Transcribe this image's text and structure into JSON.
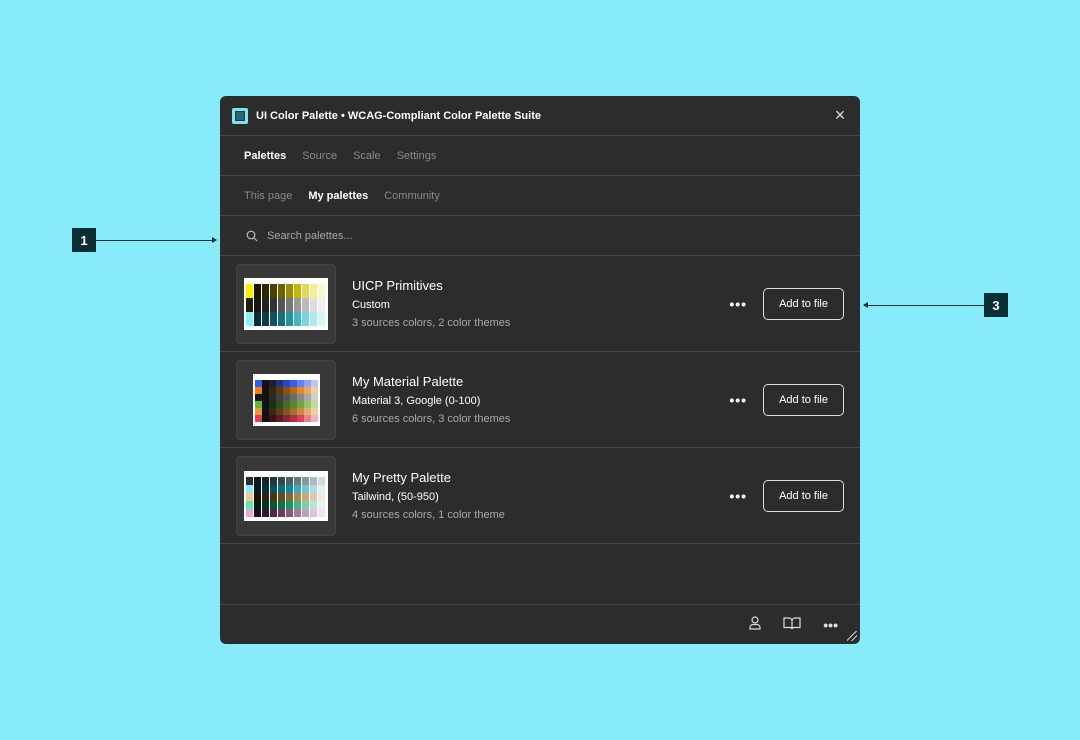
{
  "window": {
    "title": "UI Color Palette • WCAG-Compliant Color Palette Suite"
  },
  "tabs": [
    "Palettes",
    "Source",
    "Scale",
    "Settings"
  ],
  "subtabs": [
    "This page",
    "My palettes",
    "Community"
  ],
  "search": {
    "placeholder": "Search palettes..."
  },
  "palettes": [
    {
      "name": "UICP Primitives",
      "type": "Custom",
      "meta": "3 sources colors, 2 color themes",
      "action": "Add to file",
      "rows": [
        [
          "#ffee00",
          "#1a1400",
          "#2e2600",
          "#4a4000",
          "#6e6200",
          "#9a8c00",
          "#c4b600",
          "#e0d860",
          "#f4ee9a",
          "#fbf7c8"
        ],
        [
          "#221f00",
          "#151515",
          "#222",
          "#333",
          "#555",
          "#777",
          "#999",
          "#bbb",
          "#ddd",
          "#f0f0f0"
        ],
        [
          "#8aeefc",
          "#062d33",
          "#0a3d45",
          "#0f5360",
          "#17707f",
          "#2493a4",
          "#44b6c6",
          "#7bd3df",
          "#aee7ef",
          "#d6f5f9"
        ]
      ]
    },
    {
      "name": "My Material Palette",
      "type": "Material 3, Google (0-100)",
      "meta": "6 sources colors, 3 color themes",
      "action": "Add to file",
      "rows": [
        [
          "#2a5ef5",
          "#111",
          "#1b1f3a",
          "#243277",
          "#2f46b8",
          "#3a5af0",
          "#6482f5",
          "#8fa3f6",
          "#b8c6f9"
        ],
        [
          "#f57a10",
          "#111",
          "#3a2510",
          "#5c3a10",
          "#8a5410",
          "#b36e12",
          "#d98a2a",
          "#eba860",
          "#f4caa0"
        ],
        [
          "#191919",
          "#111",
          "#2a2a2a",
          "#404040",
          "#555",
          "#6c6c6c",
          "#888",
          "#a8a8a8",
          "#cfcfcf"
        ],
        [
          "#6ab530",
          "#111",
          "#1e3012",
          "#2f4d1c",
          "#436b25",
          "#58892f",
          "#70a540",
          "#92c468",
          "#bbdd9c"
        ],
        [
          "#e89a3a",
          "#111",
          "#3a2a15",
          "#5a3f1d",
          "#7d5726",
          "#a5722e",
          "#c98d3f",
          "#e0ad6a",
          "#efcfa3"
        ],
        [
          "#e8405a",
          "#111",
          "#3a1218",
          "#5e1c26",
          "#8a2636",
          "#b52e44",
          "#d9465c",
          "#e87f8e",
          "#f1b4bc"
        ]
      ]
    },
    {
      "name": "My Pretty Palette",
      "type": "Tailwind, (50-950)",
      "meta": "4 sources colors, 1 color theme",
      "action": "Add to file",
      "rows": [
        [
          "#1d3238",
          "#0c1518",
          "#17262a",
          "#23363c",
          "#33494f",
          "#4a6066",
          "#657a80",
          "#86999e",
          "#abbabd",
          "#d0dadc"
        ],
        [
          "#8ae8f8",
          "#021a20",
          "#04303a",
          "#075060",
          "#0a6b80",
          "#0d8aa0",
          "#3ba8bd",
          "#74c4d4",
          "#acdde6",
          "#dcf2f6"
        ],
        [
          "#f0cc90",
          "#1a1105",
          "#33220a",
          "#4d3410",
          "#6b4a1a",
          "#8c6630",
          "#ad8750",
          "#c8a87a",
          "#dfc9a8",
          "#f2e8d8"
        ],
        [
          "#5ee8b0",
          "#021a0e",
          "#063520",
          "#0a5533",
          "#0e7548",
          "#159860",
          "#40b585",
          "#7dd0ab",
          "#b5e6cf",
          "#e2f6ed"
        ],
        [
          "#e8a8d8",
          "#1f0a1a",
          "#361530",
          "#502548",
          "#6c3a62",
          "#8a5580",
          "#a878a0",
          "#c39dbd",
          "#dcc4d8",
          "#f1e6ef"
        ]
      ]
    }
  ],
  "annotations": [
    "1",
    "3"
  ]
}
